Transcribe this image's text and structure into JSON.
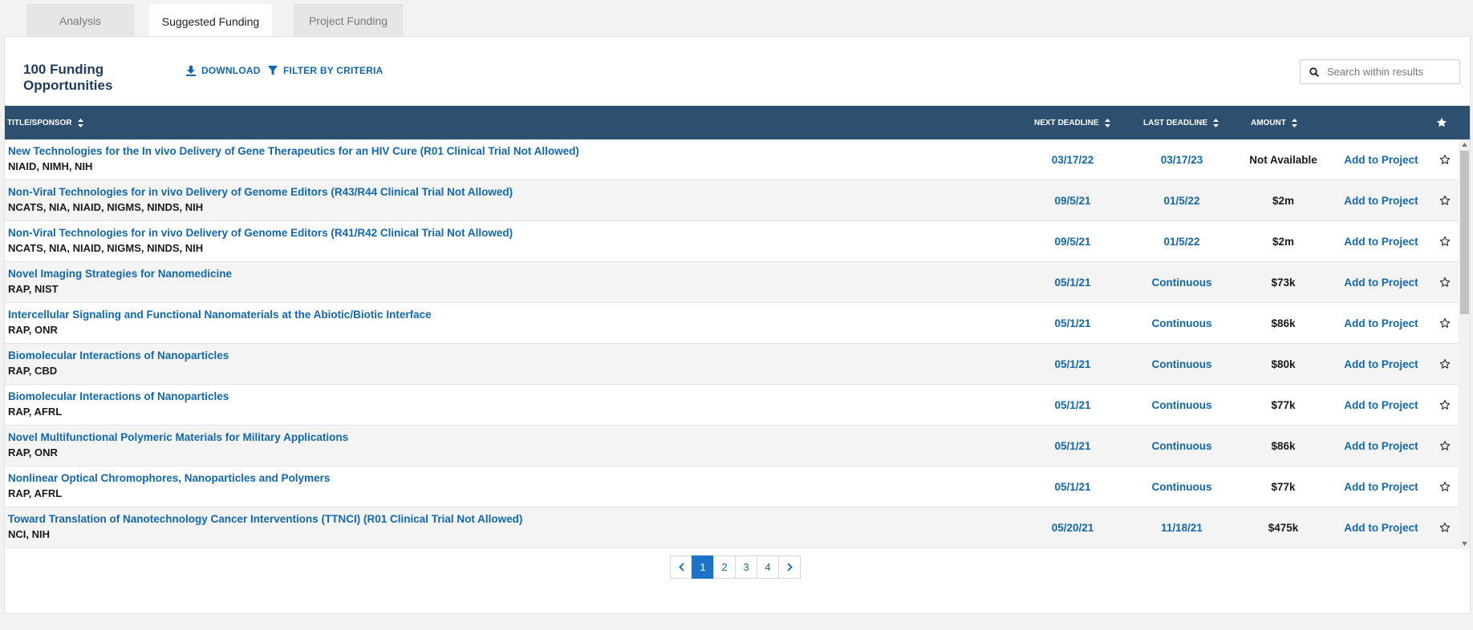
{
  "tabs": [
    {
      "label": "Analysis"
    },
    {
      "label": "Suggested Funding"
    },
    {
      "label": "Project Funding"
    }
  ],
  "header": {
    "count_title": "100 Funding Opportunities",
    "download_label": "DOWNLOAD",
    "filter_label": "FILTER BY CRITERIA",
    "search_placeholder": "Search within results"
  },
  "columns": {
    "title": "TITLE/SPONSOR",
    "next_deadline": "NEXT DEADLINE",
    "last_deadline": "LAST DEADLINE",
    "amount": "AMOUNT"
  },
  "rows": [
    {
      "title": "New Technologies for the In vivo Delivery of Gene Therapeutics for an HIV Cure (R01 Clinical Trial Not Allowed)",
      "sponsor": "NIAID, NIMH, NIH",
      "next": "03/17/22",
      "last": "03/17/23",
      "amount": "Not Available",
      "action": "Add to Project"
    },
    {
      "title": "Non-Viral Technologies for in vivo Delivery of Genome Editors (R43/R44 Clinical Trial Not Allowed)",
      "sponsor": "NCATS, NIA, NIAID, NIGMS, NINDS, NIH",
      "next": "09/5/21",
      "last": "01/5/22",
      "amount": "$2m",
      "action": "Add to Project"
    },
    {
      "title": "Non-Viral Technologies for in vivo Delivery of Genome Editors (R41/R42 Clinical Trial Not Allowed)",
      "sponsor": "NCATS, NIA, NIAID, NIGMS, NINDS, NIH",
      "next": "09/5/21",
      "last": "01/5/22",
      "amount": "$2m",
      "action": "Add to Project"
    },
    {
      "title": "Novel Imaging Strategies for Nanomedicine",
      "sponsor": "RAP, NIST",
      "next": "05/1/21",
      "last": "Continuous",
      "amount": "$73k",
      "action": "Add to Project"
    },
    {
      "title": "Intercellular Signaling and Functional Nanomaterials at the Abiotic/Biotic Interface",
      "sponsor": "RAP, ONR",
      "next": "05/1/21",
      "last": "Continuous",
      "amount": "$86k",
      "action": "Add to Project"
    },
    {
      "title": "Biomolecular Interactions of Nanoparticles",
      "sponsor": "RAP, CBD",
      "next": "05/1/21",
      "last": "Continuous",
      "amount": "$80k",
      "action": "Add to Project"
    },
    {
      "title": "Biomolecular Interactions of Nanoparticles",
      "sponsor": "RAP, AFRL",
      "next": "05/1/21",
      "last": "Continuous",
      "amount": "$77k",
      "action": "Add to Project"
    },
    {
      "title": "Novel Multifunctional Polymeric Materials for Military Applications",
      "sponsor": "RAP, ONR",
      "next": "05/1/21",
      "last": "Continuous",
      "amount": "$86k",
      "action": "Add to Project"
    },
    {
      "title": "Nonlinear Optical Chromophores, Nanoparticles and Polymers",
      "sponsor": "RAP, AFRL",
      "next": "05/1/21",
      "last": "Continuous",
      "amount": "$77k",
      "action": "Add to Project"
    },
    {
      "title": "Toward Translation of Nanotechnology Cancer Interventions (TTNCI) (R01 Clinical Trial Not Allowed)",
      "sponsor": "NCI, NIH",
      "next": "05/20/21",
      "last": "11/18/21",
      "amount": "$475k",
      "action": "Add to Project"
    }
  ],
  "pagination": {
    "pages": [
      "1",
      "2",
      "3",
      "4"
    ],
    "current": "1"
  },
  "colors": {
    "accent": "#1167b1",
    "header_bg": "#2e5070",
    "active_page": "#1a73c9"
  },
  "icons": {
    "download": "download-icon",
    "filter": "filter-icon",
    "search": "search-icon",
    "sort": "sort-icon",
    "star": "star-icon"
  }
}
